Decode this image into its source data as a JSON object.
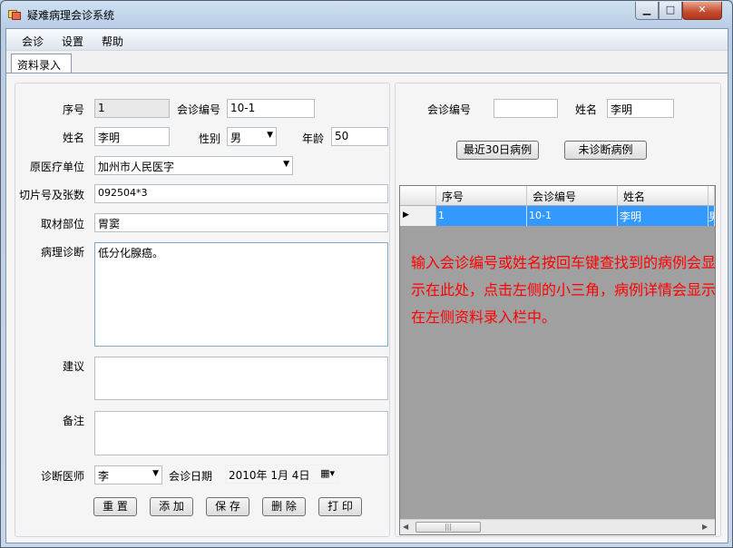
{
  "window": {
    "title": "疑难病理会诊系统",
    "minimize": "▁",
    "maximize": "□",
    "close": "✕"
  },
  "menu": [
    "会诊",
    "设置",
    "帮助"
  ],
  "tab": {
    "label": "资料录入"
  },
  "form": {
    "seq_label": "序号",
    "seq_value": "1",
    "consult_no_label": "会诊编号",
    "consult_no_value": "10-1",
    "name_label": "姓名",
    "name_value": "李明",
    "gender_label": "性别",
    "gender_value": "男",
    "age_label": "年龄",
    "age_value": "50",
    "hospital_label": "原医疗单位",
    "hospital_value": "加州市人民医字",
    "slide_label": "切片号及张数",
    "slide_value": "092504*3",
    "site_label": "取材部位",
    "site_value": "胃窦",
    "diagnosis_label": "病理诊断",
    "diagnosis_value": "低分化腺癌。",
    "advice_label": "建议",
    "advice_value": "",
    "remark_label": "备注",
    "remark_value": "",
    "doctor_label": "诊断医师",
    "doctor_value": "李",
    "date_label": "会诊日期",
    "date_value": "2010年 1月 4日"
  },
  "actions": [
    "重 置",
    "添 加",
    "保 存",
    "删 除",
    "打 印"
  ],
  "search": {
    "consult_no_label": "会诊编号",
    "consult_no_value": "",
    "name_label": "姓名",
    "name_value": "李明",
    "recent_button": "最近30日病例",
    "undiagnosed_button": "未诊断病例"
  },
  "grid": {
    "columns": [
      "序号",
      "会诊编号",
      "姓名"
    ],
    "rows": [
      {
        "seq": "1",
        "consult_no": "10-1",
        "name": "李明",
        "extra": "男"
      }
    ],
    "row_marker": "▶",
    "note": "输入会诊编号或姓名按回车键查找到的病例会显示在此处，点击左侧的小三角，病例详情会显示在左侧资料录入栏中。"
  },
  "colors": {
    "selection": "#3399ff",
    "note": "#ff0000",
    "grid_bg": "#a0a0a0"
  }
}
